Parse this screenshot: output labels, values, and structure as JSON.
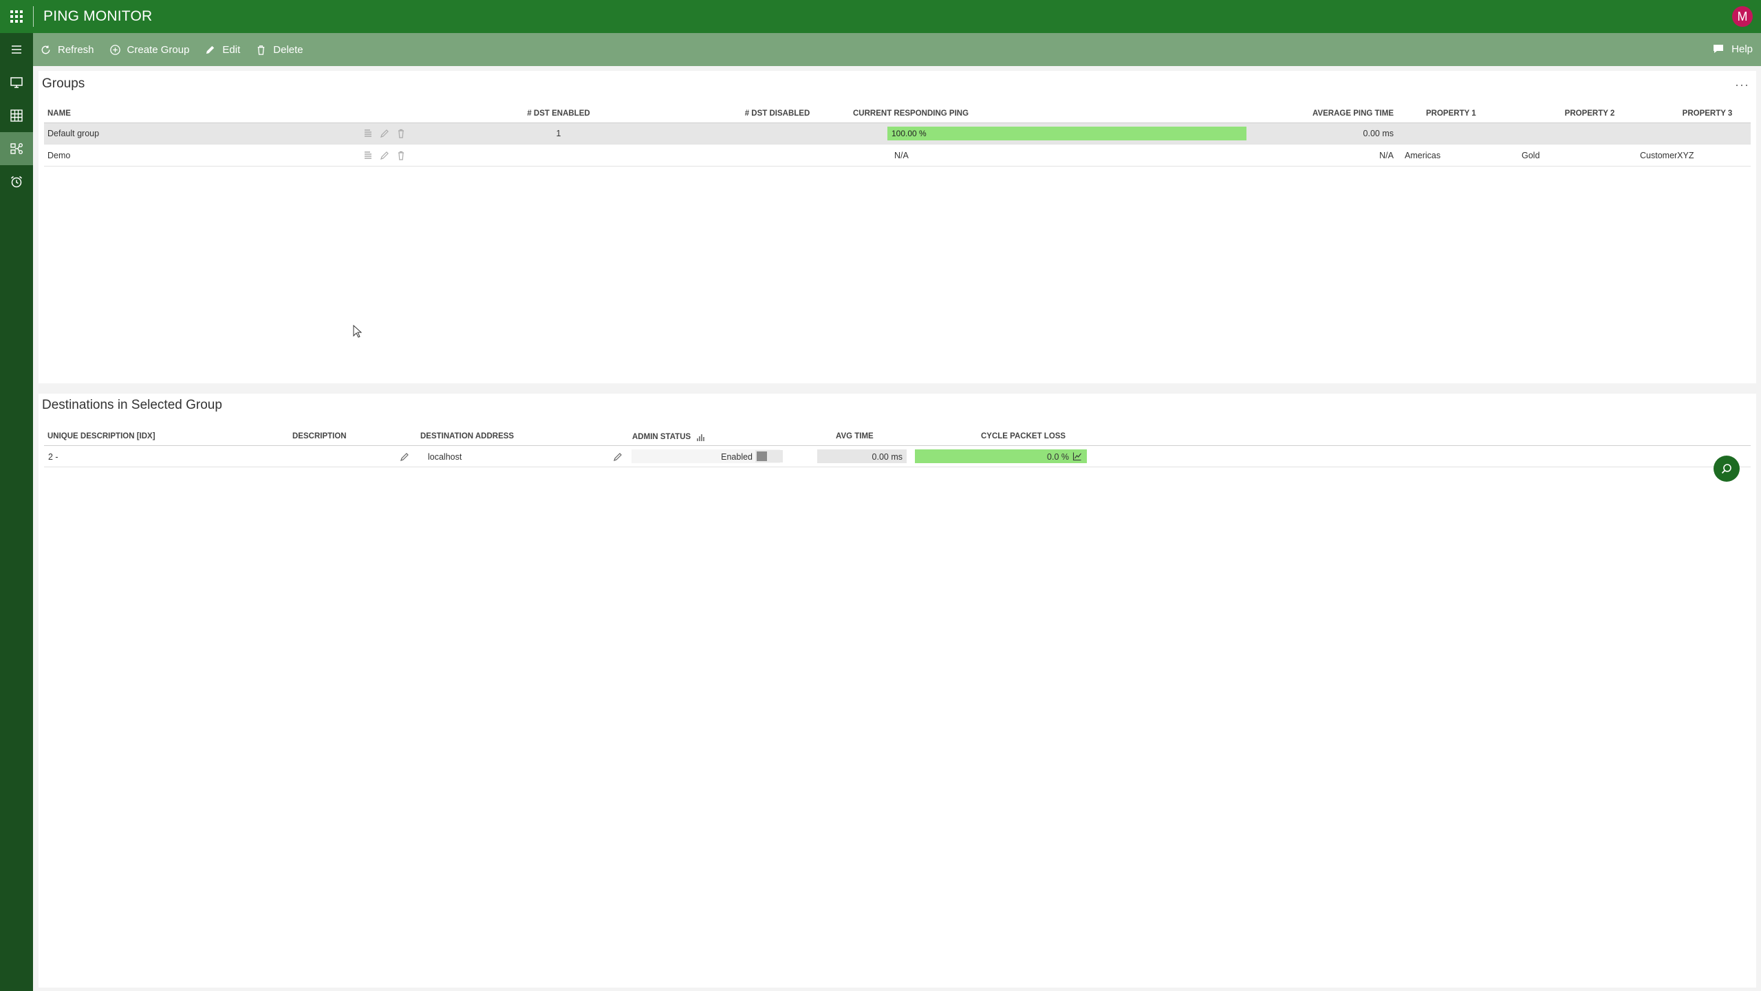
{
  "app": {
    "title": "PING MONITOR",
    "user_initial": "M",
    "brand_color": "#237a2a"
  },
  "leftnav": {
    "items": [
      {
        "icon": "hamburger-menu-icon"
      },
      {
        "icon": "monitor-icon"
      },
      {
        "icon": "grid-table-icon"
      },
      {
        "icon": "network-groups-icon",
        "active": true
      },
      {
        "icon": "alarm-clock-icon"
      }
    ]
  },
  "toolbar": {
    "refresh": "Refresh",
    "create_group": "Create Group",
    "edit": "Edit",
    "delete": "Delete",
    "help": "Help"
  },
  "groups": {
    "title": "Groups",
    "more": "···",
    "headers": {
      "name": "NAME",
      "dst_enabled": "# DST ENABLED",
      "dst_disabled": "# DST DISABLED",
      "current_ping": "CURRENT RESPONDING PING",
      "avg_ping": "AVERAGE PING TIME",
      "prop1": "PROPERTY 1",
      "prop2": "PROPERTY 2",
      "prop3": "PROPERTY 3"
    },
    "rows": [
      {
        "name": "Default group",
        "dst_enabled": "1",
        "dst_disabled": "",
        "current_ping": "100.00 %",
        "current_ping_fraction": 1.0,
        "avg_ping": "0.00 ms",
        "prop1": "",
        "prop2": "",
        "prop3": "",
        "selected": true
      },
      {
        "name": "Demo",
        "dst_enabled": "",
        "dst_disabled": "",
        "current_ping": "N/A",
        "avg_ping": "N/A",
        "prop1": "Americas",
        "prop2": "Gold",
        "prop3": "CustomerXYZ",
        "selected": false
      }
    ]
  },
  "destinations": {
    "title": "Destinations in Selected Group",
    "headers": {
      "unique_desc": "UNIQUE DESCRIPTION [IDX]",
      "description": "DESCRIPTION",
      "address": "DESTINATION ADDRESS",
      "admin_status": "ADMIN STATUS",
      "avg_time": "AVG TIME",
      "cycle_loss": "CYCLE PACKET LOSS"
    },
    "rows": [
      {
        "unique_desc": "2 -",
        "description": "",
        "address": "localhost",
        "admin_status": "Enabled",
        "avg_time": "0.00 ms",
        "cycle_loss": "0.0 %",
        "cycle_loss_fill_fraction": 1.0
      }
    ]
  }
}
